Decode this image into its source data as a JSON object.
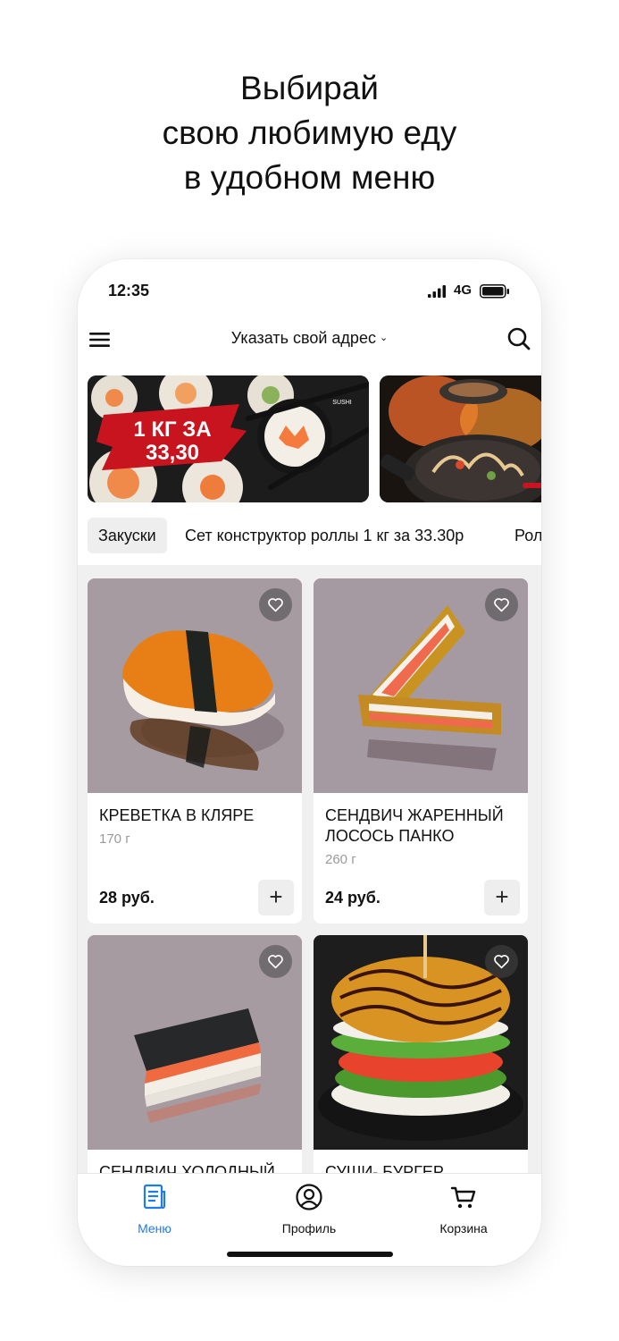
{
  "headline": {
    "line1": "Выбирай",
    "line2": "свою любимую еду",
    "line3": "в удобном меню"
  },
  "status_bar": {
    "time": "12:35",
    "network": "4G"
  },
  "app_bar": {
    "address_label": "Указать свой адрес"
  },
  "banners": [
    {
      "text_line1": "1 КГ ЗА",
      "text_line2": "33,30",
      "logo_text": "SUSHI"
    },
    {
      "text_line1": "",
      "text_line2": ""
    }
  ],
  "categories": [
    {
      "label": "Закуски",
      "active": true
    },
    {
      "label": "Сет конструктор роллы 1 кг за 33.30р",
      "active": false
    },
    {
      "label": "Рол",
      "active": false
    }
  ],
  "products": [
    {
      "name": "КРЕВЕТКА В КЛЯРЕ",
      "weight": "170 г",
      "price": "28 руб."
    },
    {
      "name": "СЕНДВИЧ ЖАРЕННЫЙ ЛОСОСЬ ПАНКО",
      "weight": "260 г",
      "price": "24 руб."
    },
    {
      "name": "СЕНДВИЧ ХОЛОДНЫЙ",
      "weight": "",
      "price": ""
    },
    {
      "name": "СУШИ- БУРГЕР",
      "weight": "",
      "price": ""
    }
  ],
  "tabs": [
    {
      "label": "Меню",
      "icon": "menu-doc-icon",
      "active": true
    },
    {
      "label": "Профиль",
      "icon": "profile-icon",
      "active": false
    },
    {
      "label": "Корзина",
      "icon": "cart-icon",
      "active": false
    }
  ],
  "colors": {
    "accent": "#1f7be6",
    "tile_background": "#a69aa0",
    "banner_red": "#c8141e"
  }
}
